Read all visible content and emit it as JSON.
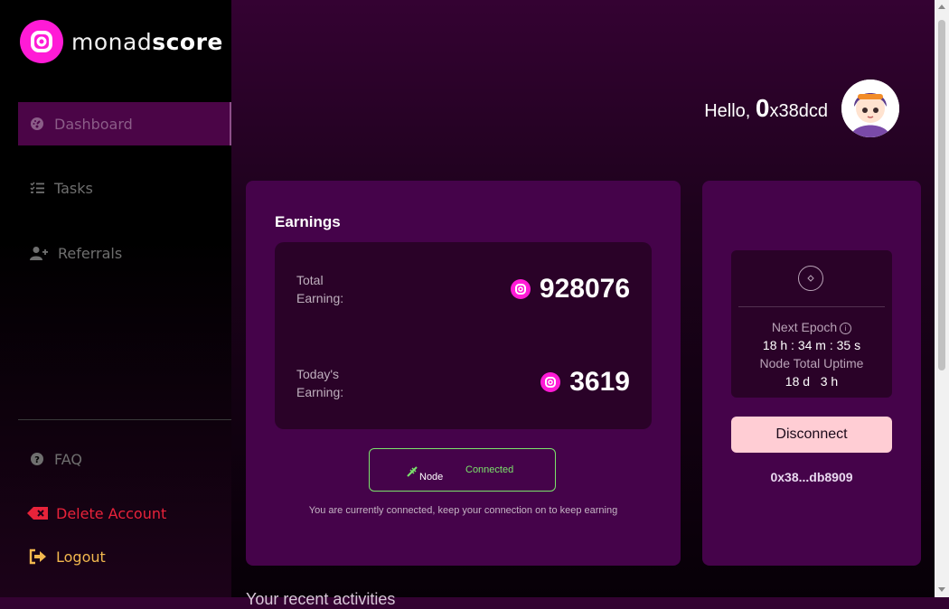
{
  "brand": {
    "name_part1": "monad",
    "name_part2": "score",
    "accent": "#ff1bd6"
  },
  "sidebar": {
    "items": [
      {
        "label": "Dashboard",
        "icon": "gauge-icon",
        "active": true
      },
      {
        "label": "Tasks",
        "icon": "checklist-icon"
      },
      {
        "label": "Referrals",
        "icon": "user-plus-icon"
      }
    ],
    "bottom": [
      {
        "label": "FAQ",
        "icon": "question-circle-icon"
      },
      {
        "label": "Delete Account",
        "icon": "delete-icon",
        "color": "#e8233a"
      },
      {
        "label": "Logout",
        "icon": "logout-icon",
        "color": "#f2b84e"
      }
    ]
  },
  "header": {
    "greeting": "Hello,",
    "address_first": "0",
    "address_rest": "x38dcd"
  },
  "earnings": {
    "title": "Earnings",
    "total_label": "Total Earning:",
    "total_value": "928076",
    "today_label": "Today's Earning:",
    "today_value": "3619",
    "node_label": "Node",
    "node_status": "Connected",
    "node_status_color": "#7be36b",
    "message": "You are currently connected, keep your connection on to keep earning"
  },
  "epoch": {
    "next_epoch_label": "Next Epoch",
    "next_epoch_time": "18 h : 34 m : 35 s",
    "uptime_label": "Node Total Uptime",
    "uptime_value": "18 d   3 h",
    "disconnect_label": "Disconnect",
    "wallet": "0x38...db8909"
  },
  "below_text": "Your recent activities"
}
